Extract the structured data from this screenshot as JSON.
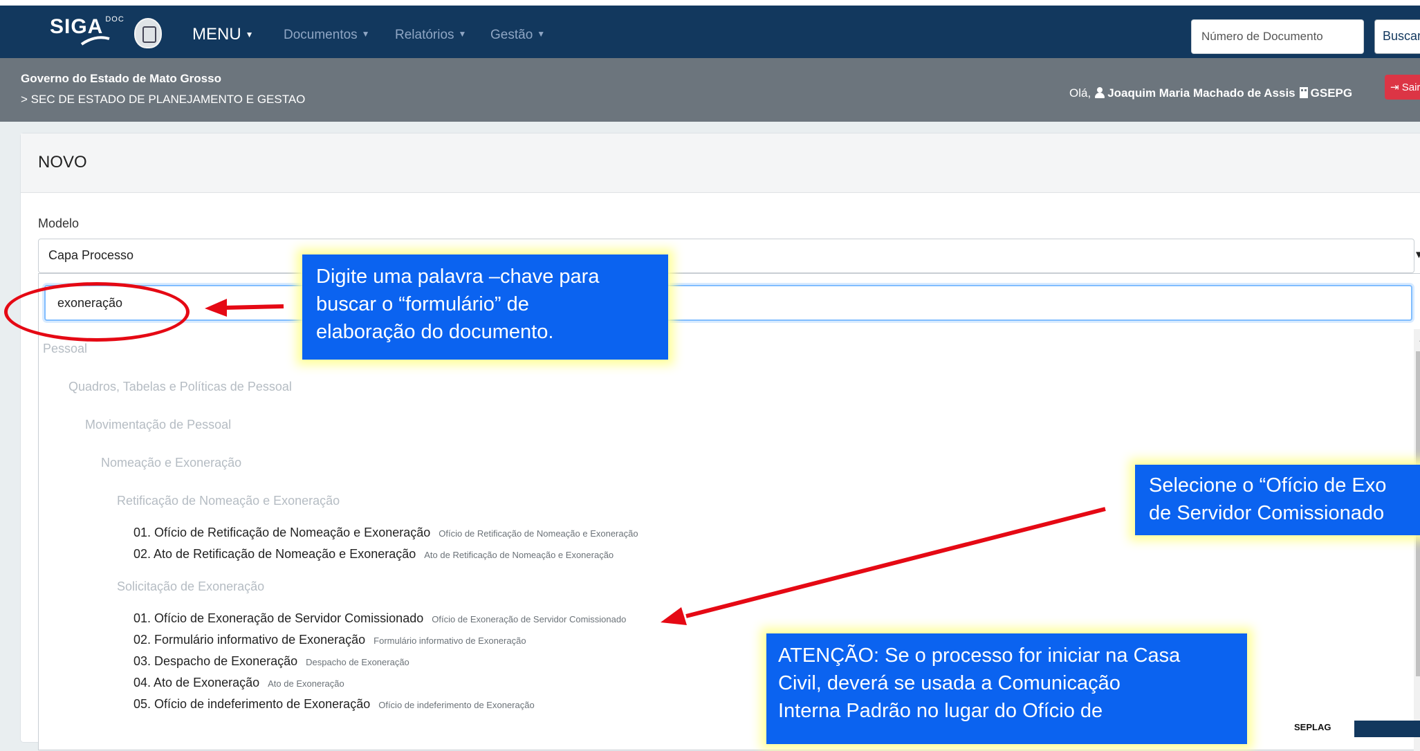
{
  "navbar": {
    "logo_text": "SIGA",
    "logo_sup": "DOC",
    "menu_label": "MENU",
    "items": [
      "Documentos",
      "Relatórios",
      "Gestão"
    ],
    "search_placeholder": "Número de Documento",
    "search_button": "Buscar"
  },
  "header": {
    "government": "Governo do Estado de Mato Grosso",
    "secretariat": "> SEC DE ESTADO DE PLANEJAMENTO E GESTAO",
    "greeting_prefix": "Olá,",
    "user_name": "Joaquim Maria Machado de Assis",
    "unit": "GSEPG",
    "logout_label": "Sair"
  },
  "card": {
    "title": "NOVO",
    "field_label": "Modelo",
    "selected_model": "Capa Processo",
    "search_value": "exoneração"
  },
  "tree": {
    "groups": [
      "Pessoal",
      "Quadros, Tabelas e Políticas de Pessoal",
      "Movimentação de Pessoal",
      "Nomeação e Exoneração",
      "Retificação de Nomeação e Exoneração",
      "Solicitação de Exoneração"
    ],
    "retificacao_items": [
      {
        "label": "01. Ofício de Retificação de Nomeação e Exoneração",
        "desc": "Ofício de Retificação de Nomeação e Exoneração"
      },
      {
        "label": "02. Ato de Retificação de Nomeação e Exoneração",
        "desc": "Ato de Retificação de Nomeação e Exoneração"
      }
    ],
    "solicitacao_items": [
      {
        "label": "01. Ofício de Exoneração de Servidor Comissionado",
        "desc": "Ofício de Exoneração de Servidor Comissionado"
      },
      {
        "label": "02. Formulário informativo de Exoneração",
        "desc": "Formulário informativo de Exoneração"
      },
      {
        "label": "03. Despacho de Exoneração",
        "desc": "Despacho de Exoneração"
      },
      {
        "label": "04. Ato de Exoneração",
        "desc": "Ato de Exoneração"
      },
      {
        "label": "05. Ofício de indeferimento de Exoneração",
        "desc": "Ofício de indeferimento de Exoneração"
      }
    ]
  },
  "annotations": {
    "search_tip": [
      "Digite uma palavra –chave para",
      "buscar o “formulário” de",
      "elaboração do documento."
    ],
    "select_tip": [
      "Selecione  o “Ofício de Exo",
      "de Servidor Comissionado"
    ],
    "warning": [
      "ATENÇÃO: Se o processo for iniciar na Casa",
      "Civil, deverá se usada a Comunicação",
      "Interna Padrão no lugar do Ofício de"
    ]
  },
  "footer": {
    "brand_text": "SEPLAG"
  },
  "colors": {
    "navbar": "#12385e",
    "subheader": "#6c757d",
    "callout": "#0b63f0",
    "highlight": "#e50914",
    "logout": "#dc3545"
  }
}
